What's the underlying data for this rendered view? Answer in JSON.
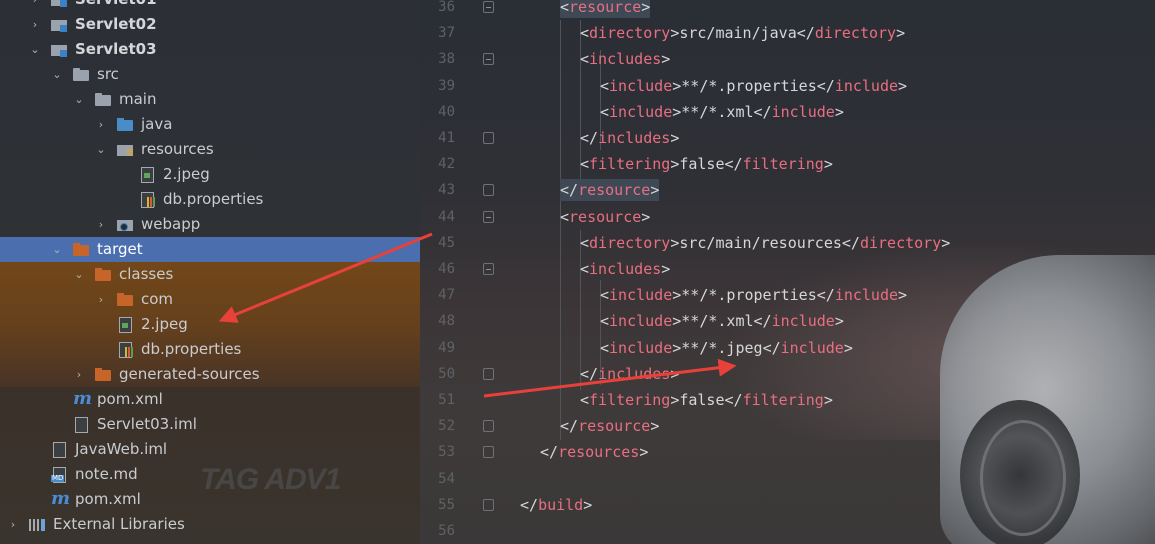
{
  "project_tree": {
    "items": [
      {
        "label": "Servlet01",
        "indent": 0,
        "arrow": "›",
        "icon": "folder-mod",
        "bold": true
      },
      {
        "label": "Servlet02",
        "indent": 0,
        "arrow": "›",
        "icon": "folder-mod",
        "bold": true
      },
      {
        "label": "Servlet03",
        "indent": 0,
        "arrow": "⌄",
        "icon": "folder-mod",
        "bold": true
      },
      {
        "label": "src",
        "indent": 1,
        "arrow": "⌄",
        "icon": "folder-grey"
      },
      {
        "label": "main",
        "indent": 2,
        "arrow": "⌄",
        "icon": "folder-grey"
      },
      {
        "label": "java",
        "indent": 3,
        "arrow": "›",
        "icon": "folder-blue"
      },
      {
        "label": "resources",
        "indent": 3,
        "arrow": "⌄",
        "icon": "folder-res"
      },
      {
        "label": "2.jpeg",
        "indent": 4,
        "arrow": "",
        "icon": "file-img"
      },
      {
        "label": "db.properties",
        "indent": 4,
        "arrow": "",
        "icon": "file-prop"
      },
      {
        "label": "webapp",
        "indent": 3,
        "arrow": "›",
        "icon": "folder-web"
      },
      {
        "label": "target",
        "indent": 1,
        "arrow": "⌄",
        "icon": "folder-orange",
        "selected": true
      },
      {
        "label": "classes",
        "indent": 2,
        "arrow": "⌄",
        "icon": "folder-orange"
      },
      {
        "label": "com",
        "indent": 3,
        "arrow": "›",
        "icon": "folder-orange"
      },
      {
        "label": "2.jpeg",
        "indent": 3,
        "arrow": "",
        "icon": "file-img",
        "noarrow_slot": true
      },
      {
        "label": "db.properties",
        "indent": 3,
        "arrow": "",
        "icon": "file-prop",
        "noarrow_slot": true
      },
      {
        "label": "generated-sources",
        "indent": 2,
        "arrow": "›",
        "icon": "folder-orange"
      },
      {
        "label": "pom.xml",
        "indent": 1,
        "arrow": "",
        "icon": "maven",
        "noarrow_slot": true
      },
      {
        "label": "Servlet03.iml",
        "indent": 1,
        "arrow": "",
        "icon": "file-iml",
        "noarrow_slot": true
      },
      {
        "label": "JavaWeb.iml",
        "indent": 0,
        "arrow": "",
        "icon": "file-iml",
        "noarrow_slot": true
      },
      {
        "label": "note.md",
        "indent": 0,
        "arrow": "",
        "icon": "file-md",
        "noarrow_slot": true
      },
      {
        "label": "pom.xml",
        "indent": 0,
        "arrow": "",
        "icon": "maven",
        "noarrow_slot": true
      },
      {
        "label": "External Libraries",
        "indent": -1,
        "arrow": "›",
        "icon": "libs"
      }
    ],
    "watermark": "TAG ADV1"
  },
  "editor": {
    "lines": [
      {
        "n": "36",
        "indent": 2,
        "parts": [
          [
            "tag",
            "<"
          ],
          [
            "t",
            "resource"
          ],
          [
            "tag",
            ">"
          ]
        ],
        "hl": true,
        "fold": "open"
      },
      {
        "n": "37",
        "indent": 3,
        "parts": [
          [
            "tag",
            "<"
          ],
          [
            "t",
            "directory"
          ],
          [
            "tag",
            ">"
          ],
          [
            "x",
            "src/main/java"
          ],
          [
            "tag",
            "</"
          ],
          [
            "t",
            "directory"
          ],
          [
            "tag",
            ">"
          ]
        ]
      },
      {
        "n": "38",
        "indent": 3,
        "parts": [
          [
            "tag",
            "<"
          ],
          [
            "t",
            "includes"
          ],
          [
            "tag",
            ">"
          ]
        ],
        "fold": "open"
      },
      {
        "n": "39",
        "indent": 4,
        "parts": [
          [
            "tag",
            "<"
          ],
          [
            "t",
            "include"
          ],
          [
            "tag",
            ">"
          ],
          [
            "x",
            "**/*.properties"
          ],
          [
            "tag",
            "</"
          ],
          [
            "t",
            "include"
          ],
          [
            "tag",
            ">"
          ]
        ]
      },
      {
        "n": "40",
        "indent": 4,
        "parts": [
          [
            "tag",
            "<"
          ],
          [
            "t",
            "include"
          ],
          [
            "tag",
            ">"
          ],
          [
            "x",
            "**/*.xml"
          ],
          [
            "tag",
            "</"
          ],
          [
            "t",
            "include"
          ],
          [
            "tag",
            ">"
          ]
        ]
      },
      {
        "n": "41",
        "indent": 3,
        "parts": [
          [
            "tag",
            "</"
          ],
          [
            "t",
            "includes"
          ],
          [
            "tag",
            ">"
          ]
        ],
        "fold": "close"
      },
      {
        "n": "42",
        "indent": 3,
        "parts": [
          [
            "tag",
            "<"
          ],
          [
            "t",
            "filtering"
          ],
          [
            "tag",
            ">"
          ],
          [
            "x",
            "false"
          ],
          [
            "tag",
            "</"
          ],
          [
            "t",
            "filtering"
          ],
          [
            "tag",
            ">"
          ]
        ]
      },
      {
        "n": "43",
        "indent": 2,
        "parts": [
          [
            "tag",
            "</"
          ],
          [
            "t",
            "resource"
          ],
          [
            "tag",
            ">"
          ]
        ],
        "hl": true,
        "fold": "close"
      },
      {
        "n": "44",
        "indent": 2,
        "parts": [
          [
            "tag",
            "<"
          ],
          [
            "t",
            "resource"
          ],
          [
            "tag",
            ">"
          ]
        ],
        "fold": "open"
      },
      {
        "n": "45",
        "indent": 3,
        "parts": [
          [
            "tag",
            "<"
          ],
          [
            "t",
            "directory"
          ],
          [
            "tag",
            ">"
          ],
          [
            "x",
            "src/main/resources"
          ],
          [
            "tag",
            "</"
          ],
          [
            "t",
            "directory"
          ],
          [
            "tag",
            ">"
          ]
        ]
      },
      {
        "n": "46",
        "indent": 3,
        "parts": [
          [
            "tag",
            "<"
          ],
          [
            "t",
            "includes"
          ],
          [
            "tag",
            ">"
          ]
        ],
        "fold": "open"
      },
      {
        "n": "47",
        "indent": 4,
        "parts": [
          [
            "tag",
            "<"
          ],
          [
            "t",
            "include"
          ],
          [
            "tag",
            ">"
          ],
          [
            "x",
            "**/*.properties"
          ],
          [
            "tag",
            "</"
          ],
          [
            "t",
            "include"
          ],
          [
            "tag",
            ">"
          ]
        ]
      },
      {
        "n": "48",
        "indent": 4,
        "parts": [
          [
            "tag",
            "<"
          ],
          [
            "t",
            "include"
          ],
          [
            "tag",
            ">"
          ],
          [
            "x",
            "**/*.xml"
          ],
          [
            "tag",
            "</"
          ],
          [
            "t",
            "include"
          ],
          [
            "tag",
            ">"
          ]
        ]
      },
      {
        "n": "49",
        "indent": 4,
        "parts": [
          [
            "tag",
            "<"
          ],
          [
            "t",
            "include"
          ],
          [
            "tag",
            ">"
          ],
          [
            "x",
            "**/*.jpeg"
          ],
          [
            "tag",
            "</"
          ],
          [
            "t",
            "include"
          ],
          [
            "tag",
            ">"
          ]
        ]
      },
      {
        "n": "50",
        "indent": 3,
        "parts": [
          [
            "tag",
            "</"
          ],
          [
            "t",
            "includes"
          ],
          [
            "tag",
            ">"
          ]
        ],
        "fold": "close"
      },
      {
        "n": "51",
        "indent": 3,
        "parts": [
          [
            "tag",
            "<"
          ],
          [
            "t",
            "filtering"
          ],
          [
            "tag",
            ">"
          ],
          [
            "x",
            "false"
          ],
          [
            "tag",
            "</"
          ],
          [
            "t",
            "filtering"
          ],
          [
            "tag",
            ">"
          ]
        ]
      },
      {
        "n": "52",
        "indent": 2,
        "parts": [
          [
            "tag",
            "</"
          ],
          [
            "t",
            "resource"
          ],
          [
            "tag",
            ">"
          ]
        ],
        "fold": "close"
      },
      {
        "n": "53",
        "indent": 1,
        "parts": [
          [
            "tag",
            "</"
          ],
          [
            "t",
            "resources"
          ],
          [
            "tag",
            ">"
          ]
        ],
        "fold": "close"
      },
      {
        "n": "54",
        "indent": 0,
        "parts": []
      },
      {
        "n": "55",
        "indent": 0,
        "parts": [
          [
            "tag",
            "</"
          ],
          [
            "t",
            "build"
          ],
          [
            "tag",
            ">"
          ]
        ],
        "fold": "close"
      },
      {
        "n": "56",
        "indent": 0,
        "parts": []
      }
    ]
  },
  "colors": {
    "selection": "#4b6eaf",
    "tag": "#e86f80",
    "text": "#d5d7d9",
    "annotation_arrow": "#e8413a"
  }
}
